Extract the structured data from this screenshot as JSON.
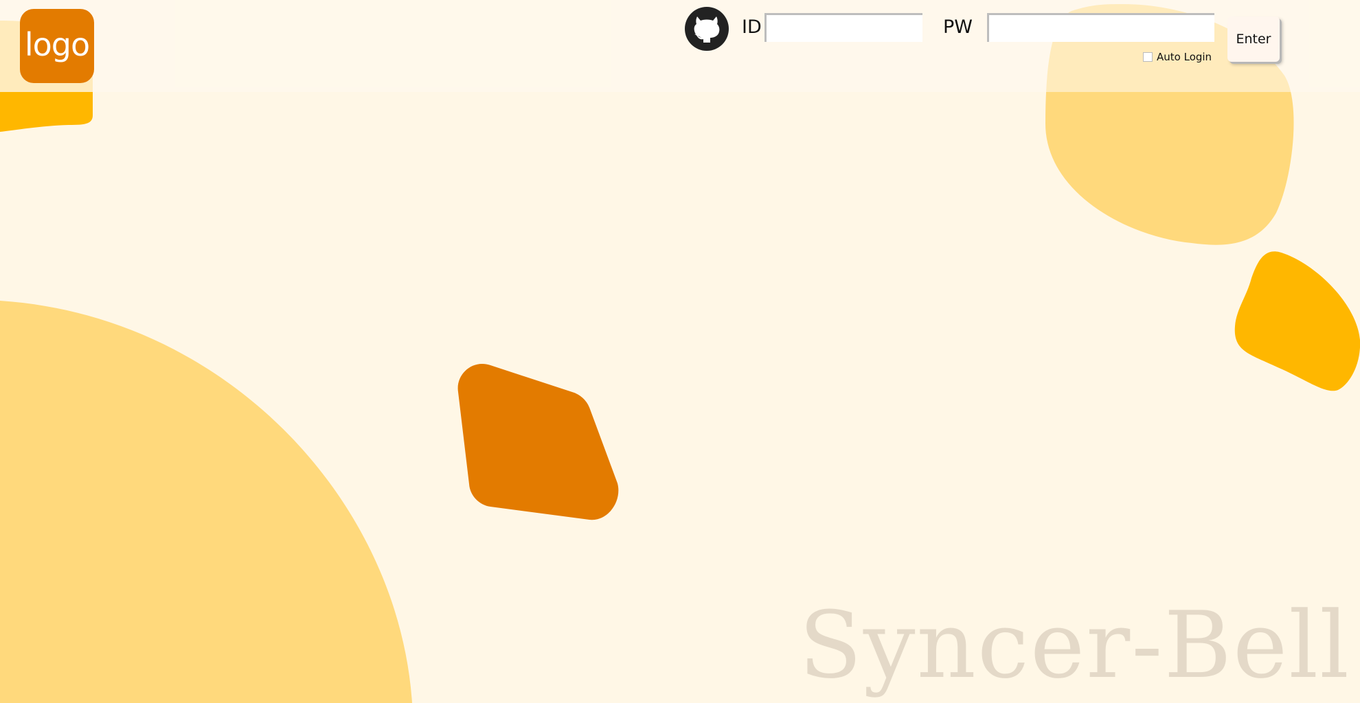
{
  "header": {
    "logo_text": "logo",
    "github_icon": "github-icon",
    "id_label": "ID",
    "id_value": "",
    "pw_label": "PW",
    "pw_value": "",
    "enter_label": "Enter",
    "auto_login_label": "Auto Login",
    "auto_login_checked": false
  },
  "brand_text": "Syncer-Bell",
  "colors": {
    "background": "#fff7e6",
    "logo": "#e37b00",
    "blob_light": "#ffd97c",
    "blob_mid": "#ffb700",
    "blob_dark": "#e37b00",
    "brand_text": "#e4d9c8"
  }
}
